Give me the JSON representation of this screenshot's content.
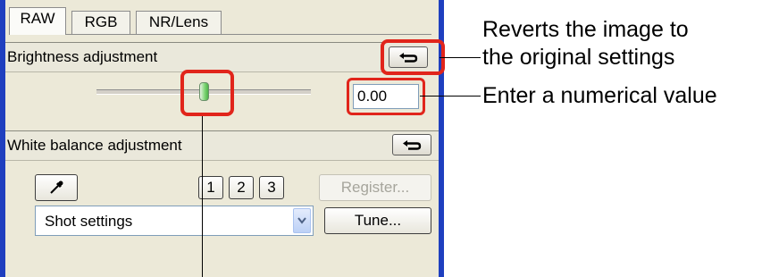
{
  "tabs": [
    {
      "label": "RAW"
    },
    {
      "label": "RGB"
    },
    {
      "label": "NR/Lens"
    }
  ],
  "brightness": {
    "title": "Brightness adjustment",
    "value": "0.00",
    "slider_level": 0.5
  },
  "white_balance": {
    "title": "White balance adjustment",
    "presets": [
      "1",
      "2",
      "3"
    ],
    "register_label": "Register...",
    "selected": "Shot settings",
    "tune_label": "Tune..."
  },
  "callouts": {
    "revert_line1": "Reverts the image to",
    "revert_line2": "the original settings",
    "numeric": "Enter a numerical value"
  },
  "colors": {
    "highlight": "#e1251b",
    "window_border": "#1f3fbf",
    "panel_bg": "#ece9d8"
  }
}
